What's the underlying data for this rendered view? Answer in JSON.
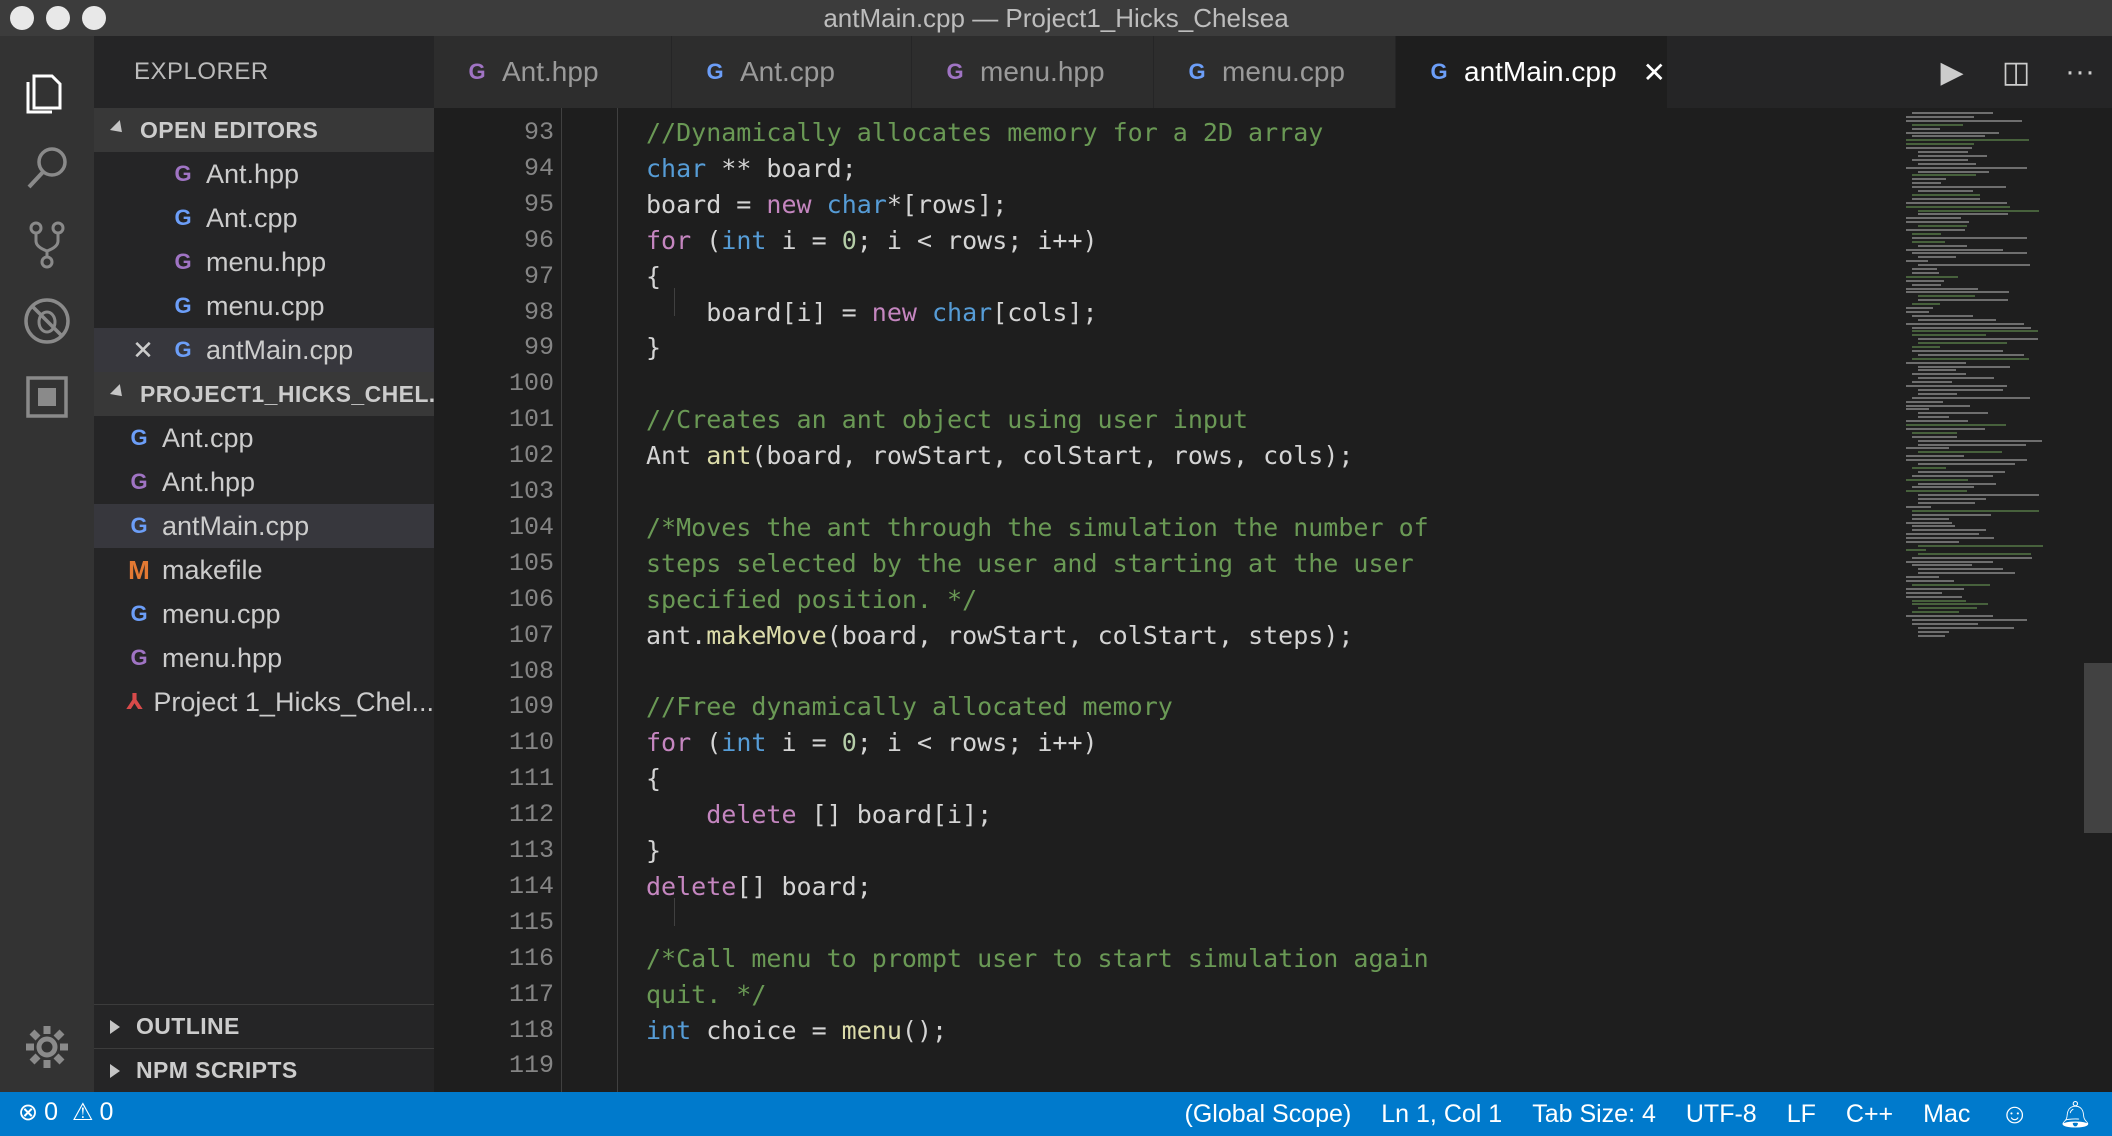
{
  "window": {
    "title": "antMain.cpp — Project1_Hicks_Chelsea"
  },
  "activity_bar": {
    "icons": [
      "explorer-icon",
      "search-icon",
      "source-control-icon",
      "debug-icon",
      "extensions-icon",
      "gear-icon"
    ]
  },
  "sidebar": {
    "title": "EXPLORER",
    "open_editors": {
      "label": "OPEN EDITORS",
      "files": [
        {
          "name": "Ant.hpp",
          "kind": "hpp"
        },
        {
          "name": "Ant.cpp",
          "kind": "cpp"
        },
        {
          "name": "menu.hpp",
          "kind": "hpp"
        },
        {
          "name": "menu.cpp",
          "kind": "cpp"
        },
        {
          "name": "antMain.cpp",
          "kind": "cpp"
        }
      ]
    },
    "project": {
      "label": "PROJECT1_HICKS_CHEL...",
      "files": [
        {
          "name": "Ant.cpp",
          "kind": "cpp"
        },
        {
          "name": "Ant.hpp",
          "kind": "hpp"
        },
        {
          "name": "antMain.cpp",
          "kind": "cpp"
        },
        {
          "name": "makefile",
          "kind": "make"
        },
        {
          "name": "menu.cpp",
          "kind": "cpp"
        },
        {
          "name": "menu.hpp",
          "kind": "hpp"
        },
        {
          "name": "Project 1_Hicks_Chel...",
          "kind": "pdf"
        }
      ]
    },
    "outline_label": "OUTLINE",
    "npm_label": "NPM SCRIPTS"
  },
  "tabs": [
    {
      "label": "Ant.hpp",
      "kind": "hpp"
    },
    {
      "label": "Ant.cpp",
      "kind": "cpp"
    },
    {
      "label": "menu.hpp",
      "kind": "hpp"
    },
    {
      "label": "menu.cpp",
      "kind": "cpp"
    },
    {
      "label": "antMain.cpp",
      "kind": "cpp",
      "active": true
    }
  ],
  "tab_actions": {
    "run": "▶",
    "split": "◫",
    "more": "···"
  },
  "editor": {
    "lines": [
      {
        "n": "93",
        "t": "//Dynamically allocates memory for a 2D array"
      },
      {
        "n": "94",
        "t": "char ** board;"
      },
      {
        "n": "95",
        "t": "board = new char*[rows];"
      },
      {
        "n": "96",
        "t": "for (int i = 0; i < rows; i++)"
      },
      {
        "n": "97",
        "t": "{"
      },
      {
        "n": "98",
        "t": "    board[i] = new char[cols];"
      },
      {
        "n": "99",
        "t": "}"
      },
      {
        "n": "100",
        "t": ""
      },
      {
        "n": "101",
        "t": "//Creates an ant object using user input"
      },
      {
        "n": "102",
        "t": "Ant ant(board, rowStart, colStart, rows, cols);"
      },
      {
        "n": "103",
        "t": ""
      },
      {
        "n": "104",
        "t": "/*Moves the ant through the simulation the number of"
      },
      {
        "n": "105",
        "t": "steps selected by the user and starting at the user"
      },
      {
        "n": "106",
        "t": "specified position. */"
      },
      {
        "n": "107",
        "t": "ant.makeMove(board, rowStart, colStart, steps);"
      },
      {
        "n": "108",
        "t": ""
      },
      {
        "n": "109",
        "t": "//Free dynamically allocated memory"
      },
      {
        "n": "110",
        "t": "for (int i = 0; i < rows; i++)"
      },
      {
        "n": "111",
        "t": "{"
      },
      {
        "n": "112",
        "t": "    delete [] board[i];"
      },
      {
        "n": "113",
        "t": "}"
      },
      {
        "n": "114",
        "t": "delete[] board;"
      },
      {
        "n": "115",
        "t": ""
      },
      {
        "n": "116",
        "t": "/*Call menu to prompt user to start simulation again"
      },
      {
        "n": "117",
        "t": "quit. */"
      },
      {
        "n": "118",
        "t": "int choice = menu();"
      },
      {
        "n": "119",
        "t": ""
      }
    ]
  },
  "status": {
    "errors": "0",
    "warnings": "0",
    "scope": "(Global Scope)",
    "position": "Ln 1, Col 1",
    "tab_size": "Tab Size: 4",
    "encoding": "UTF-8",
    "eol": "LF",
    "language": "C++",
    "platform": "Mac"
  },
  "colors": {
    "status_bar": "#007acc",
    "keyword": "#c586c0",
    "type": "#569cd6",
    "comment": "#6a9955",
    "function": "#dcdcaa",
    "number": "#b5cea8"
  }
}
